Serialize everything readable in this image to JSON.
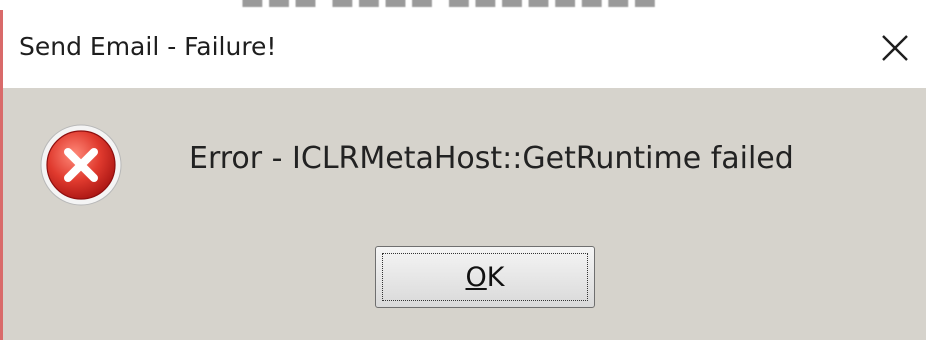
{
  "dialog": {
    "title": "Send Email - Failure!",
    "message": "Error - ICLRMetaHost::GetRuntime failed",
    "icon": "error-icon",
    "ok_label_mnemonic": "O",
    "ok_label_rest": "K",
    "close_icon": "close-icon"
  },
  "colors": {
    "dialog_bg": "#d6d3cc",
    "titlebar_bg": "#ffffff",
    "error_red": "#d62a2a",
    "accent_border": "#d96a6a"
  }
}
